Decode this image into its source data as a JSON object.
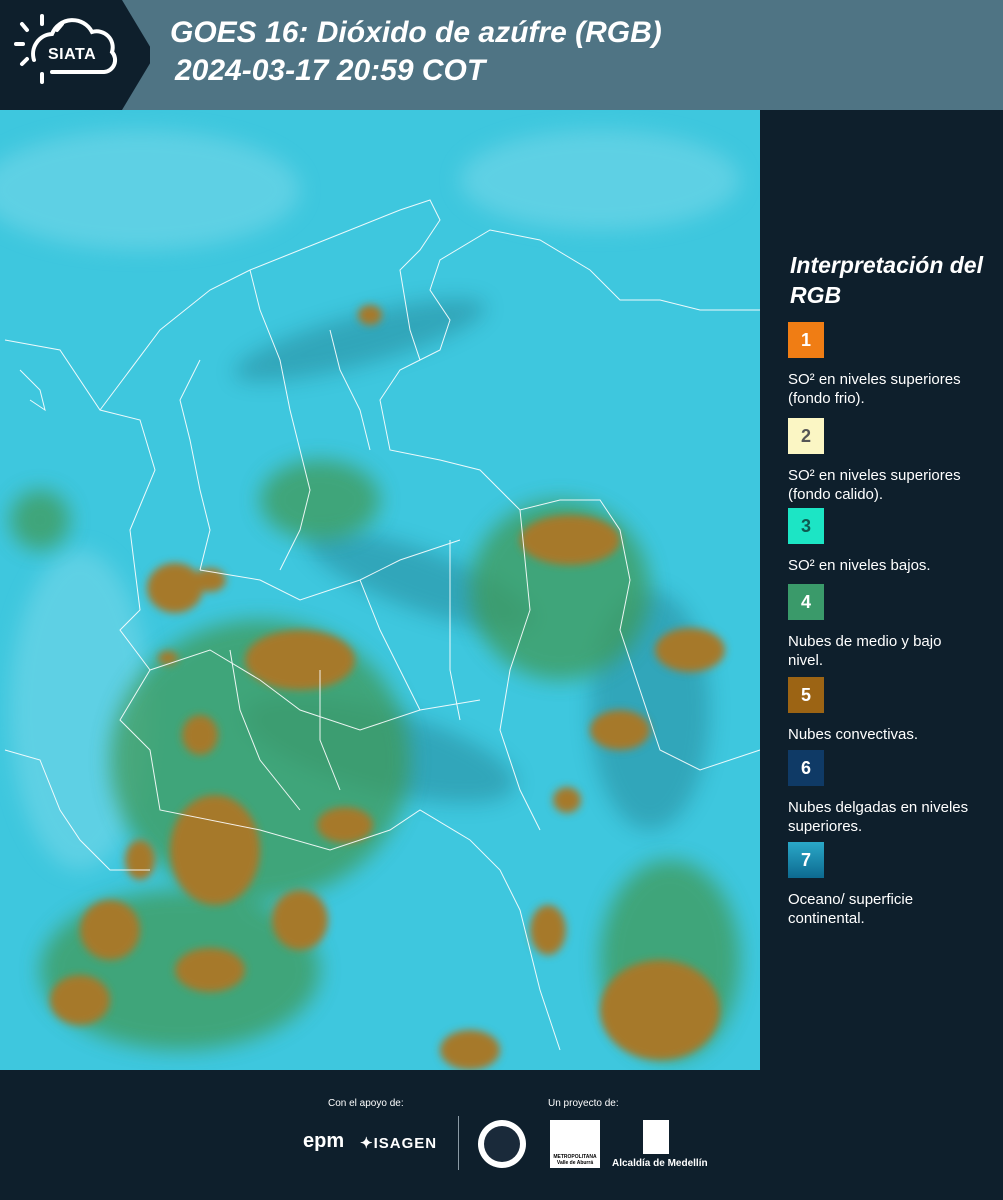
{
  "header": {
    "logo_text": "SIATA",
    "title_line1": "GOES 16: Dióxido de azúfre (RGB)",
    "title_line2": "2024-03-17 20:59 COT"
  },
  "legend": {
    "title": "Interpretación del RGB",
    "items": [
      {
        "number": "1",
        "color": "#f07d14",
        "label": "SO² en niveles superiores (fondo frio)."
      },
      {
        "number": "2",
        "color": "#fbf6c4",
        "label": "SO² en niveles superiores (fondo calido)."
      },
      {
        "number": "3",
        "color": "#1ce5c5",
        "label": "SO² en niveles bajos."
      },
      {
        "number": "4",
        "color": "#3a9a6a",
        "label": "Nubes de medio y bajo nivel."
      },
      {
        "number": "5",
        "color": "#9c6414",
        "label": "Nubes convectivas."
      },
      {
        "number": "6",
        "color": "#0f3a66",
        "label": "Nubes delgadas en niveles superiores."
      },
      {
        "number": "7",
        "color": "#1a8cb4",
        "label": "Oceano/ superficie continental."
      }
    ]
  },
  "footer": {
    "support_label": "Con el apoyo de:",
    "project_label": "Un proyecto de:",
    "sponsor1": "epm",
    "sponsor2": "ISAGEN",
    "partner_area": "METROPOLITANA Valle de Aburrá",
    "partner_alcaldia": "Alcaldía de Medellín"
  },
  "map": {
    "background_color": "#3ec7de",
    "cloud_color": "#a6792a",
    "vegetation_color": "#3f9a58",
    "border_color": "#ffffff"
  }
}
